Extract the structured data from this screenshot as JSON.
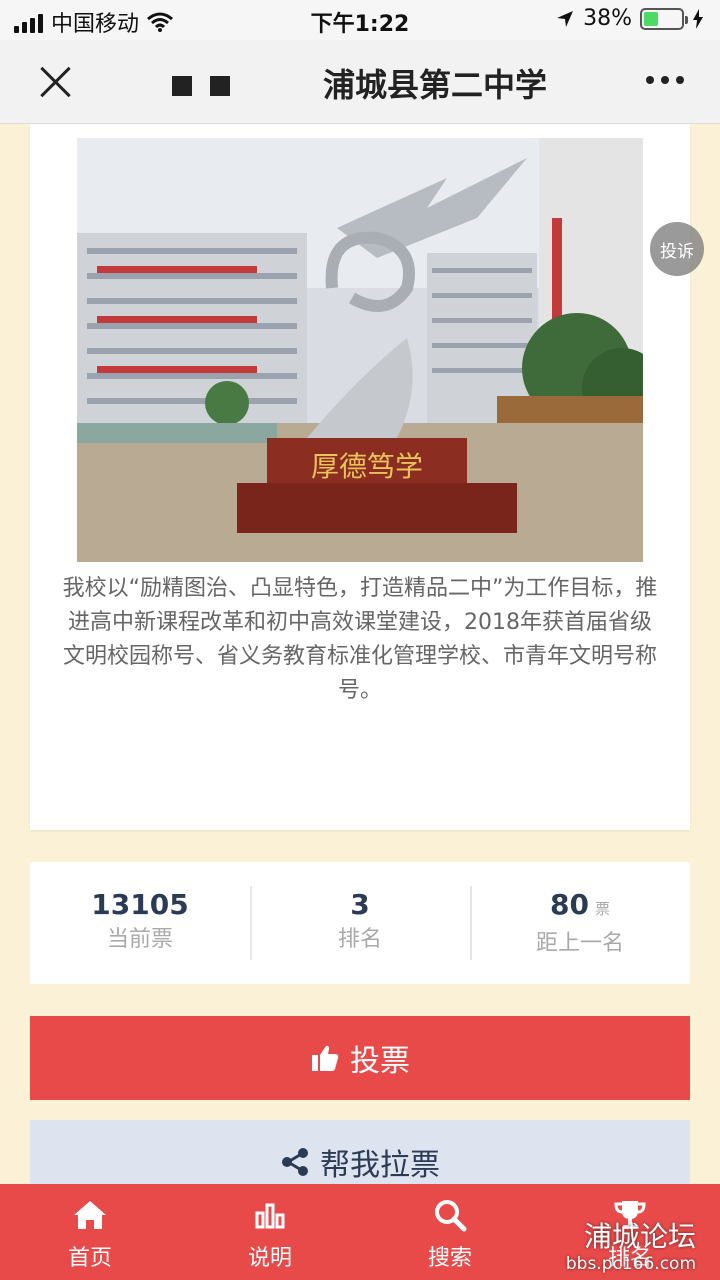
{
  "status_bar": {
    "carrier": "中国移动",
    "time": "下午1:22",
    "battery_percent": "38%",
    "battery_level": 0.38
  },
  "nav": {
    "title": "浦城县第二中学"
  },
  "card": {
    "photo_inscription": "厚德笃学",
    "description": "我校以“励精图治、凸显特色，打造精品二中”为工作目标，推进高中新课程改革和初中高效课堂建设，2018年获首届省级文明校园称号、省义务教育标准化管理学校、市青年文明号称号。",
    "complaint_label": "投诉"
  },
  "stats": {
    "votes": {
      "value": "13105",
      "label": "当前票"
    },
    "rank": {
      "value": "3",
      "label": "排名"
    },
    "gap": {
      "value": "80",
      "unit": "票",
      "label": "距上一名"
    }
  },
  "buttons": {
    "vote_label": "投票",
    "share_label": "帮我拉票"
  },
  "tabs": [
    {
      "label": "首页",
      "icon": "home-icon"
    },
    {
      "label": "说明",
      "icon": "bar-chart-icon"
    },
    {
      "label": "搜索",
      "icon": "search-icon"
    },
    {
      "label": "排名",
      "icon": "trophy-icon"
    }
  ],
  "watermark": {
    "title": "浦城论坛",
    "url": "bbs.pc166.com"
  },
  "colors": {
    "accent_red": "#e84a4a",
    "share_bg": "#dde4ef",
    "page_bg": "#fbf1d7"
  }
}
